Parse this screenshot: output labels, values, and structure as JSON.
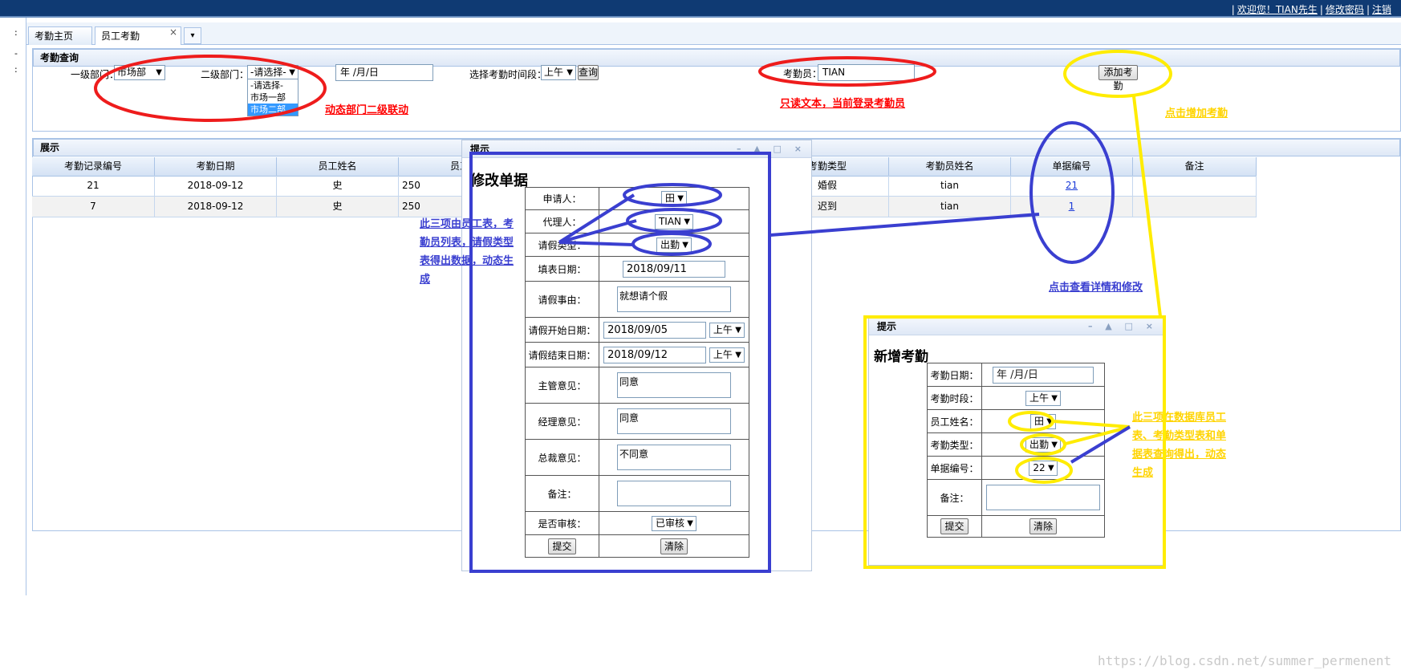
{
  "header": {
    "welcome": "欢迎您！TIAN先生",
    "change_password": "修改密码",
    "logout": "注销"
  },
  "tabs": [
    {
      "label": "考勤主页"
    },
    {
      "label": "员工考勤",
      "close": "×"
    }
  ],
  "tab_menu_icon": "▾",
  "query_panel": {
    "title": "考勤查询",
    "dept1_label": "一级部门：",
    "dept1_value": "市场部",
    "dept2_label": "二级部门：",
    "dept2_value": "-请选择-",
    "dept2_options": [
      "-请选择-",
      "市场一部",
      "市场二部"
    ],
    "date_placeholder": "年 /月/日",
    "period_label": "选择考勤时间段：",
    "period_value": "上午",
    "query_button": "查询",
    "attendant_label": "考勤员：",
    "attendant_value": "TIAN",
    "add_button": "添加考勤"
  },
  "grid": {
    "title": "展示",
    "columns": [
      "考勤记录编号",
      "考勤日期",
      "员工姓名",
      "员工",
      "考勤类型",
      "考勤员姓名",
      "单据编号",
      "备注"
    ],
    "rows": [
      {
        "id": "21",
        "date": "2018-09-12",
        "name": "史",
        "emp": "250",
        "type": "婚假",
        "attendant": "tian",
        "doc": "21",
        "note": ""
      },
      {
        "id": "7",
        "date": "2018-09-12",
        "name": "史",
        "emp": "250",
        "type": "迟到",
        "attendant": "tian",
        "doc": "1",
        "note": ""
      }
    ]
  },
  "edit_dialog": {
    "title": "提示",
    "heading": "修改单据",
    "fields": {
      "applicant_label": "申请人：",
      "applicant_value": "田",
      "agent_label": "代理人：",
      "agent_value": "TIAN",
      "leave_type_label": "请假类型：",
      "leave_type_value": "出勤",
      "fill_date_label": "填表日期：",
      "fill_date_value": "2018/09/11",
      "reason_label": "请假事由：",
      "reason_value": "就想请个假",
      "start_label": "请假开始日期：",
      "start_value": "2018/09/05",
      "start_period": "上午",
      "end_label": "请假结束日期：",
      "end_value": "2018/09/12",
      "end_period": "上午",
      "supervisor_label": "主管意见：",
      "supervisor_value": "同意",
      "manager_label": "经理意见：",
      "manager_value": "同意",
      "ceo_label": "总裁意见：",
      "ceo_value": "不同意",
      "remark_label": "备注：",
      "remark_value": "",
      "reviewed_label": "是否审核：",
      "reviewed_value": "已审核",
      "submit": "提交",
      "clear": "清除"
    }
  },
  "add_dialog": {
    "title": "提示",
    "heading": "新增考勤",
    "fields": {
      "date_label": "考勤日期：",
      "date_value": "年 /月/日",
      "period_label": "考勤时段：",
      "period_value": "上午",
      "name_label": "员工姓名：",
      "name_value": "田",
      "type_label": "考勤类型：",
      "type_value": "出勤",
      "doc_label": "单据编号：",
      "doc_value": "22",
      "remark_label": "备注：",
      "remark_value": "",
      "submit": "提交",
      "clear": "清除"
    }
  },
  "annotations": {
    "cascade": "动态部门二级联动",
    "readonly": "只读文本，当前登录考勤员",
    "click_add": "点击增加考勤",
    "dynamic_three": "此三项由员工表，考勤员列表，请假类型表得出数据，动态生成",
    "click_detail": "点击查看详情和修改",
    "db_three": "此三项在数据库员工表、考勤类型表和单据表查询得出，动态生成"
  },
  "watermark": "https://blog.csdn.net/summer_permenent",
  "colors": {
    "header_bg": "#0f3a73",
    "annotation_red": "#ff0000",
    "annotation_blue": "#3a3fd0",
    "annotation_yellow": "#ffec00"
  }
}
